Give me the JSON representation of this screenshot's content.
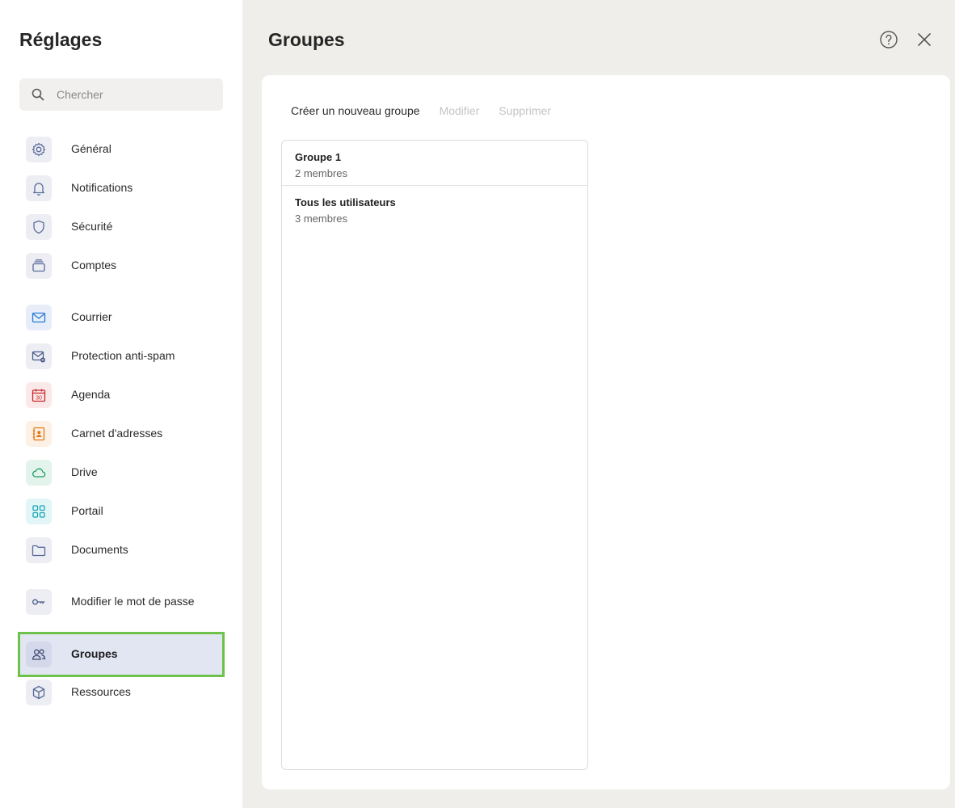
{
  "sidebar": {
    "title": "Réglages",
    "search": {
      "placeholder": "Chercher",
      "value": ""
    },
    "items": [
      {
        "key": "general",
        "label": "Général",
        "icon": "gear-icon"
      },
      {
        "key": "notifications",
        "label": "Notifications",
        "icon": "bell-icon"
      },
      {
        "key": "securite",
        "label": "Sécurité",
        "icon": "shield-icon"
      },
      {
        "key": "comptes",
        "label": "Comptes",
        "icon": "accounts-icon"
      },
      {
        "key": "courrier",
        "label": "Courrier",
        "icon": "envelope-icon"
      },
      {
        "key": "antispam",
        "label": "Protection anti-spam",
        "icon": "spam-envelope-icon"
      },
      {
        "key": "agenda",
        "label": "Agenda",
        "icon": "calendar-icon",
        "icon_text": "30"
      },
      {
        "key": "carnet",
        "label": "Carnet d'adresses",
        "icon": "address-book-icon"
      },
      {
        "key": "drive",
        "label": "Drive",
        "icon": "cloud-icon"
      },
      {
        "key": "portail",
        "label": "Portail",
        "icon": "grid-icon"
      },
      {
        "key": "documents",
        "label": "Documents",
        "icon": "folder-icon"
      },
      {
        "key": "password",
        "label": "Modifier le mot de passe",
        "icon": "key-icon"
      },
      {
        "key": "groupes",
        "label": "Groupes",
        "icon": "users-icon",
        "active": true
      },
      {
        "key": "ressources",
        "label": "Ressources",
        "icon": "cube-icon"
      }
    ]
  },
  "main": {
    "title": "Groupes",
    "toolbar": {
      "create_label": "Créer un nouveau groupe",
      "edit_label": "Modifier",
      "delete_label": "Supprimer"
    },
    "groups": [
      {
        "name": "Groupe 1",
        "members": "2 membres"
      },
      {
        "name": "Tous les utilisateurs",
        "members": "3 membres"
      }
    ]
  },
  "colors": {
    "accent": "#6cc24a",
    "active_bg": "#e2e6f3",
    "page_bg": "#efeeeb"
  }
}
